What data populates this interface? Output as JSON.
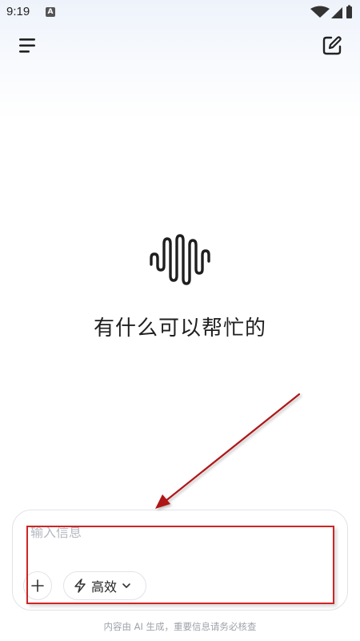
{
  "status_bar": {
    "time": "9:19",
    "notification_icon": "A"
  },
  "header": {
    "menu_icon": "menu-icon",
    "new_chat_icon": "edit-icon"
  },
  "hero": {
    "logo_icon": "waveform-logo-icon",
    "greeting": "有什么可以帮忙的"
  },
  "composer": {
    "placeholder": "输入信息",
    "value": "",
    "add_icon": "plus-icon",
    "mode_icon": "lightning-icon",
    "mode_label": "高效"
  },
  "footer": {
    "disclaimer": "内容由 AI 生成，重要信息请务必核查"
  },
  "colors": {
    "annotation": "#d02424",
    "annotation_arrow": "#b01818"
  }
}
